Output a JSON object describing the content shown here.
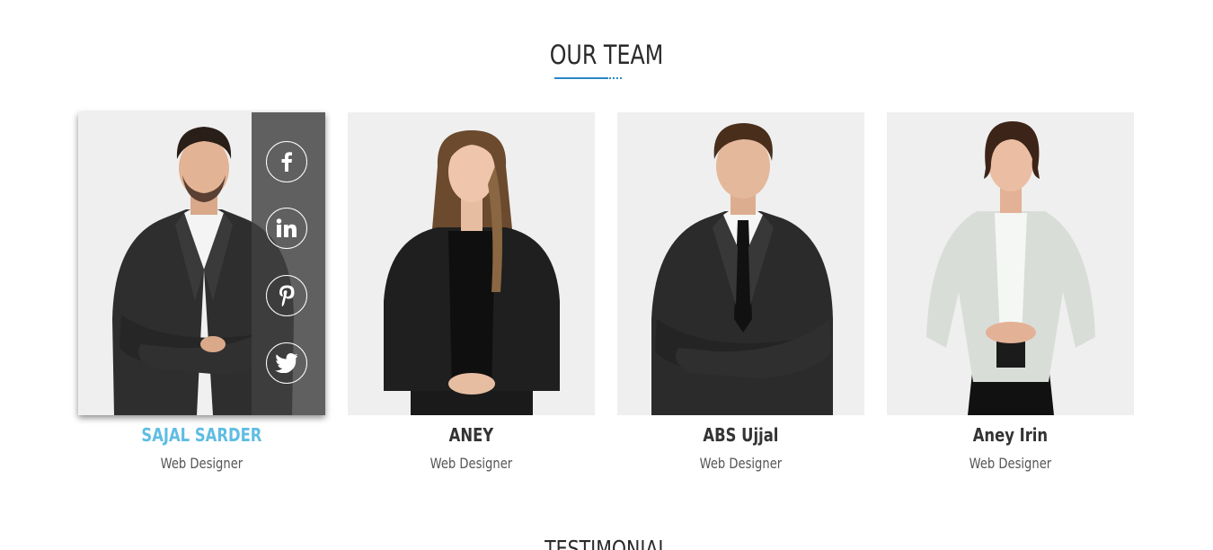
{
  "section": {
    "title": "OUR TEAM"
  },
  "team": [
    {
      "name": "SAJAL SARDER",
      "role": "Web Designer",
      "photo": "man-in-dark-suit-arms-crossed",
      "highlighted": true,
      "social": [
        {
          "icon": "facebook-icon",
          "label": "f"
        },
        {
          "icon": "linkedin-icon",
          "label": "in"
        },
        {
          "icon": "pinterest-icon",
          "label": "p"
        },
        {
          "icon": "twitter-icon",
          "label": "bird"
        }
      ]
    },
    {
      "name": "ANEY",
      "role": "Web Designer",
      "photo": "woman-in-leather-jacket"
    },
    {
      "name": "ABS Ujjal",
      "role": "Web Designer",
      "photo": "man-in-suit-and-tie-arms-crossed"
    },
    {
      "name": "Aney Irin",
      "role": "Web Designer",
      "photo": "woman-in-light-blazer"
    }
  ],
  "next_section": {
    "title": "TESTIMONIAL"
  },
  "colors": {
    "accent": "#5fbde3",
    "underline": "#2a87c6",
    "card_bg": "#efefef",
    "overlay": "#414141"
  }
}
